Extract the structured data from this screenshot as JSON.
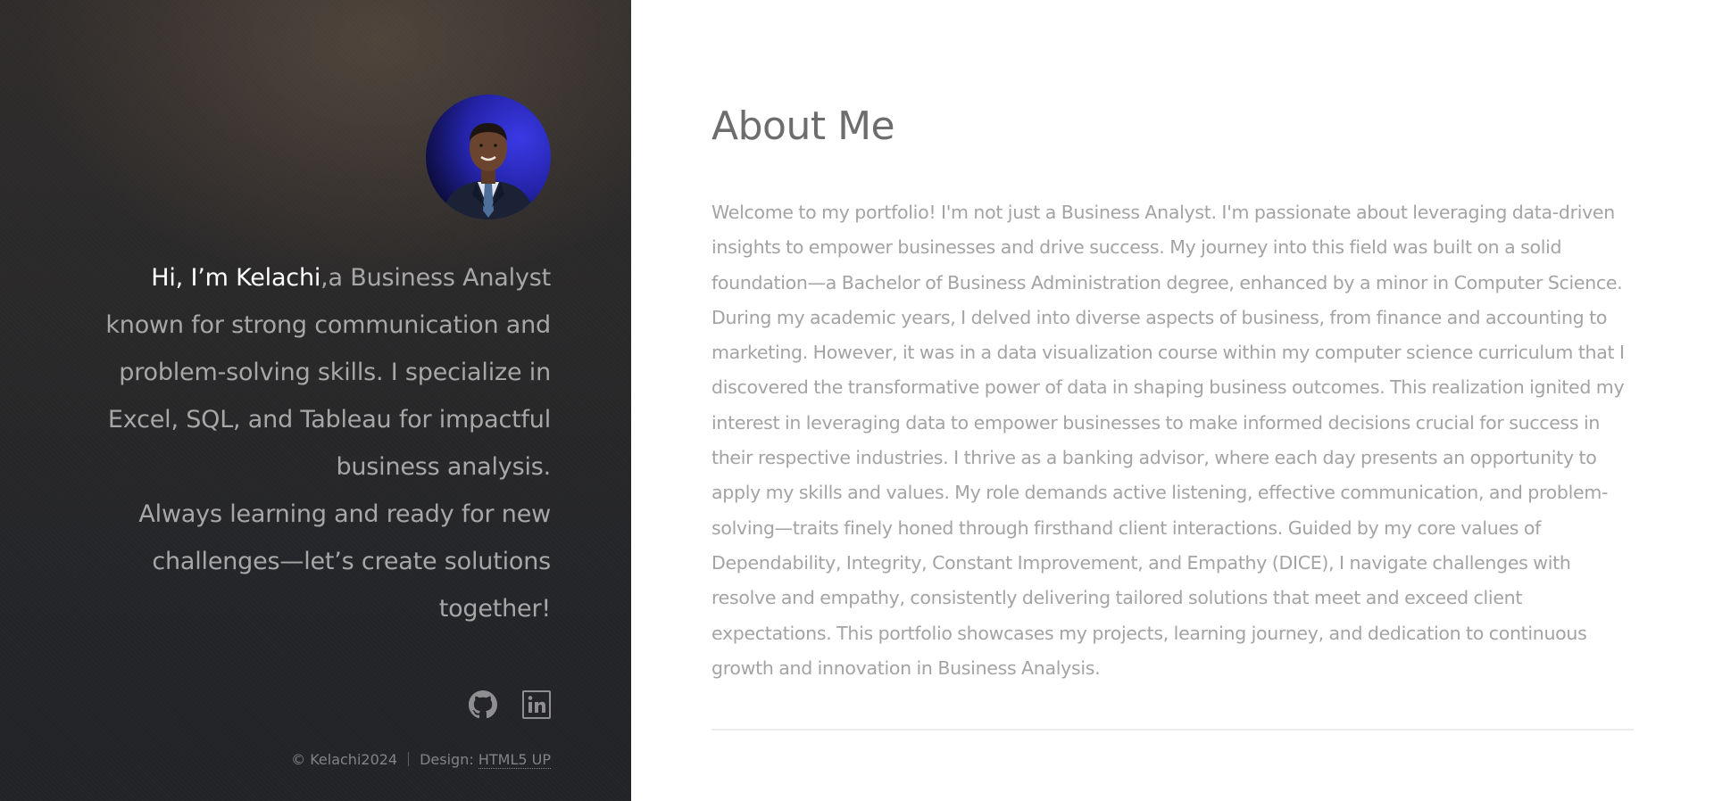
{
  "sidebar": {
    "intro_name": "Hi, I’m Kelachi",
    "intro_rest": ",a Business Analyst known for strong communication and problem-solving skills. I specialize in Excel, SQL, and Tableau for impactful business analysis.",
    "intro_second": "Always learning and ready for new challenges—let’s create solutions together!",
    "social": [
      {
        "icon": "github-icon"
      },
      {
        "icon": "linkedin-icon"
      }
    ],
    "footer": {
      "copyright": "© Kelachi2024",
      "design_label": "Design:",
      "design_link": "HTML5 UP"
    }
  },
  "main": {
    "title": "About Me",
    "body": "Welcome to my portfolio! I'm not just a Business Analyst. I'm passionate about leveraging data-driven insights to empower businesses and drive success. My journey into this field was built on a solid foundation—a Bachelor of Business Administration degree, enhanced by a minor in Computer Science. During my academic years, I delved into diverse aspects of business, from finance and accounting to marketing. However, it was in a data visualization course within my computer science curriculum that I discovered the transformative power of data in shaping business outcomes. This realization ignited my interest in leveraging data to empower businesses to make informed decisions crucial for success in their respective industries. I thrive as a banking advisor, where each day presents an opportunity to apply my skills and values. My role demands active listening, effective communication, and problem-solving—traits finely honed through firsthand client interactions. Guided by my core values of Dependability, Integrity, Constant Improvement, and Empathy (DICE), I navigate challenges with resolve and empathy, consistently delivering tailored solutions that meet and exceed client expectations. This portfolio showcases my projects, learning journey, and dedication to continuous growth and innovation in Business Analysis."
  }
}
